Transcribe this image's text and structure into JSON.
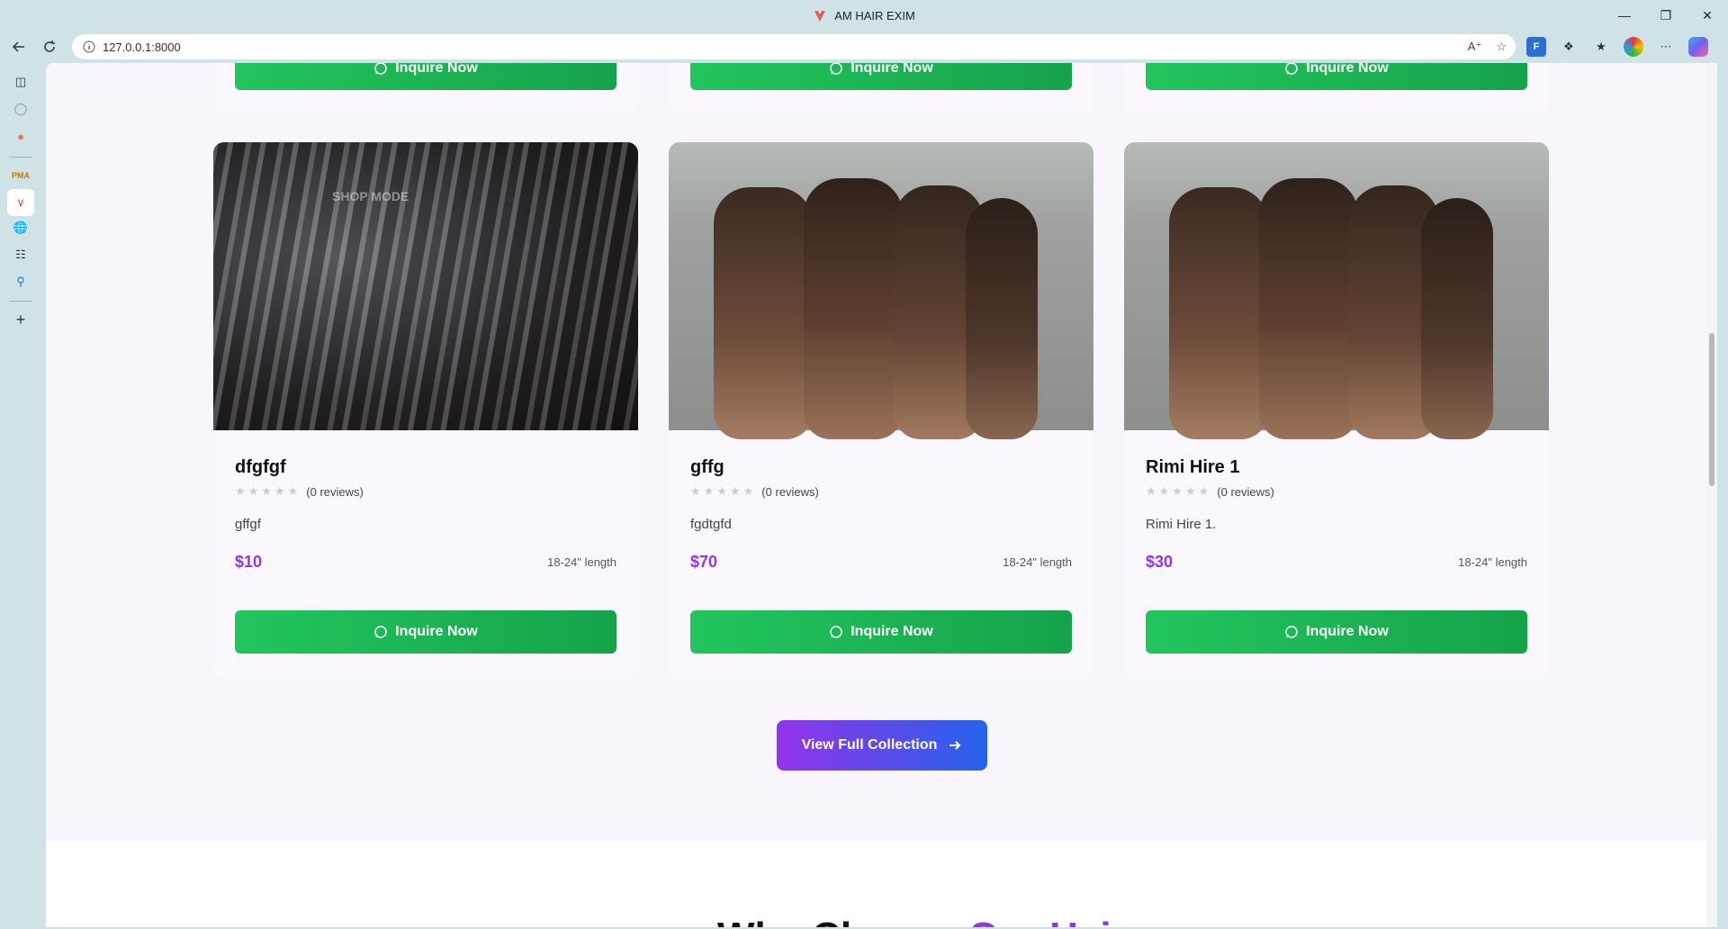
{
  "browser": {
    "window_title": "AM HAIR EXIM",
    "url": "127.0.0.1:8000"
  },
  "products_top_row": [
    {
      "button_label": "Inquire Now"
    },
    {
      "button_label": "Inquire Now"
    },
    {
      "button_label": "Inquire Now"
    }
  ],
  "products": [
    {
      "name": "dfgfgf",
      "reviews": "(0 reviews)",
      "description": "gffgf",
      "price": "$10",
      "length": "18-24\" length",
      "button_label": "Inquire Now",
      "watermark": "SHOP MODE"
    },
    {
      "name": "gffg",
      "reviews": "(0 reviews)",
      "description": "fgdtgfd",
      "price": "$70",
      "length": "18-24\" length",
      "button_label": "Inquire Now"
    },
    {
      "name": "Rimi Hire 1",
      "reviews": "(0 reviews)",
      "description": "Rimi Hire 1.",
      "price": "$30",
      "length": "18-24\" length",
      "button_label": "Inquire Now"
    }
  ],
  "rating": {
    "stars": 0,
    "max": 5
  },
  "view_collection_label": "View Full Collection",
  "why_section": {
    "heading_start": "Why Choose ",
    "heading_accent": "Our Hair"
  },
  "colors": {
    "accent_green": "#22c55e",
    "accent_purple": "#9333ea",
    "accent_blue": "#2563eb"
  }
}
